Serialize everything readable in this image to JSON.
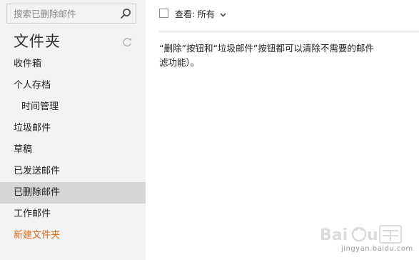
{
  "search": {
    "placeholder": "搜索已删除邮件"
  },
  "sidebar": {
    "title": "文件夹",
    "items": [
      {
        "label": "收件箱"
      },
      {
        "label": "个人存档"
      },
      {
        "label": "时间管理"
      },
      {
        "label": "垃圾邮件"
      },
      {
        "label": "草稿"
      },
      {
        "label": "已发送邮件"
      },
      {
        "label": "已删除邮件"
      },
      {
        "label": "工作邮件"
      }
    ],
    "selected_item": "已删除邮件",
    "new_folder_label": "新建文件夹"
  },
  "toolbar": {
    "view_label": "查看: 所有"
  },
  "main": {
    "message_line1": "“删除”按钮和“垃圾邮件”按钮都可以清除不需要的邮件",
    "message_line2": "滤功能）。"
  },
  "watermark": {
    "brand": "Baidu 经验",
    "url": "jingyan.baidu.com"
  },
  "colors": {
    "sidebar_bg": "#f3f3f3",
    "selected_bg": "#d6d6d6",
    "new_folder": "#d86a1e"
  }
}
